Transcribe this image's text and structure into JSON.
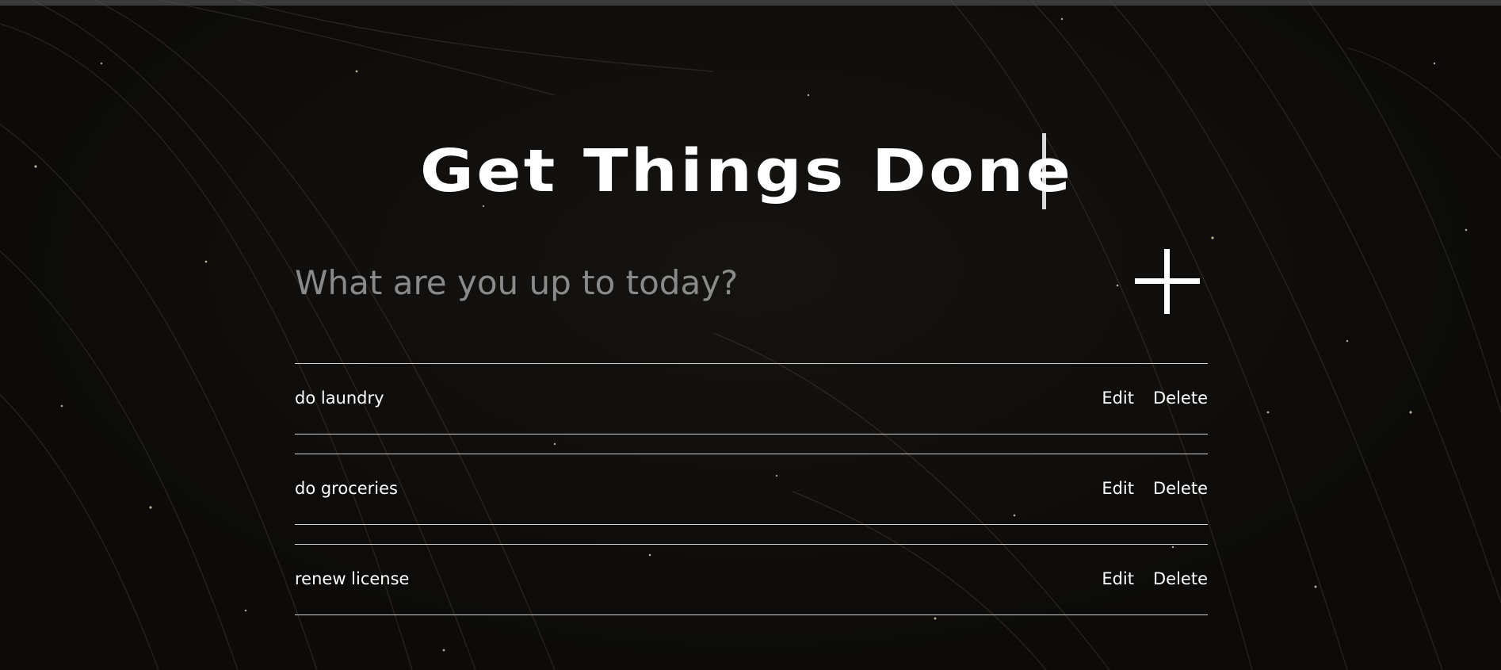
{
  "app": {
    "title": "Get Things Done"
  },
  "input": {
    "placeholder": "What are you up to today?",
    "value": ""
  },
  "add_button": {
    "icon": "plus-icon"
  },
  "tasks": [
    {
      "text": "do laundry",
      "edit_label": "Edit",
      "delete_label": "Delete"
    },
    {
      "text": "do groceries",
      "edit_label": "Edit",
      "delete_label": "Delete"
    },
    {
      "text": "renew license",
      "edit_label": "Edit",
      "delete_label": "Delete"
    }
  ],
  "colors": {
    "background": "#0c0b0a",
    "text": "#ffffff",
    "placeholder": "#8a8a8a",
    "divider": "#d0d0d0"
  }
}
